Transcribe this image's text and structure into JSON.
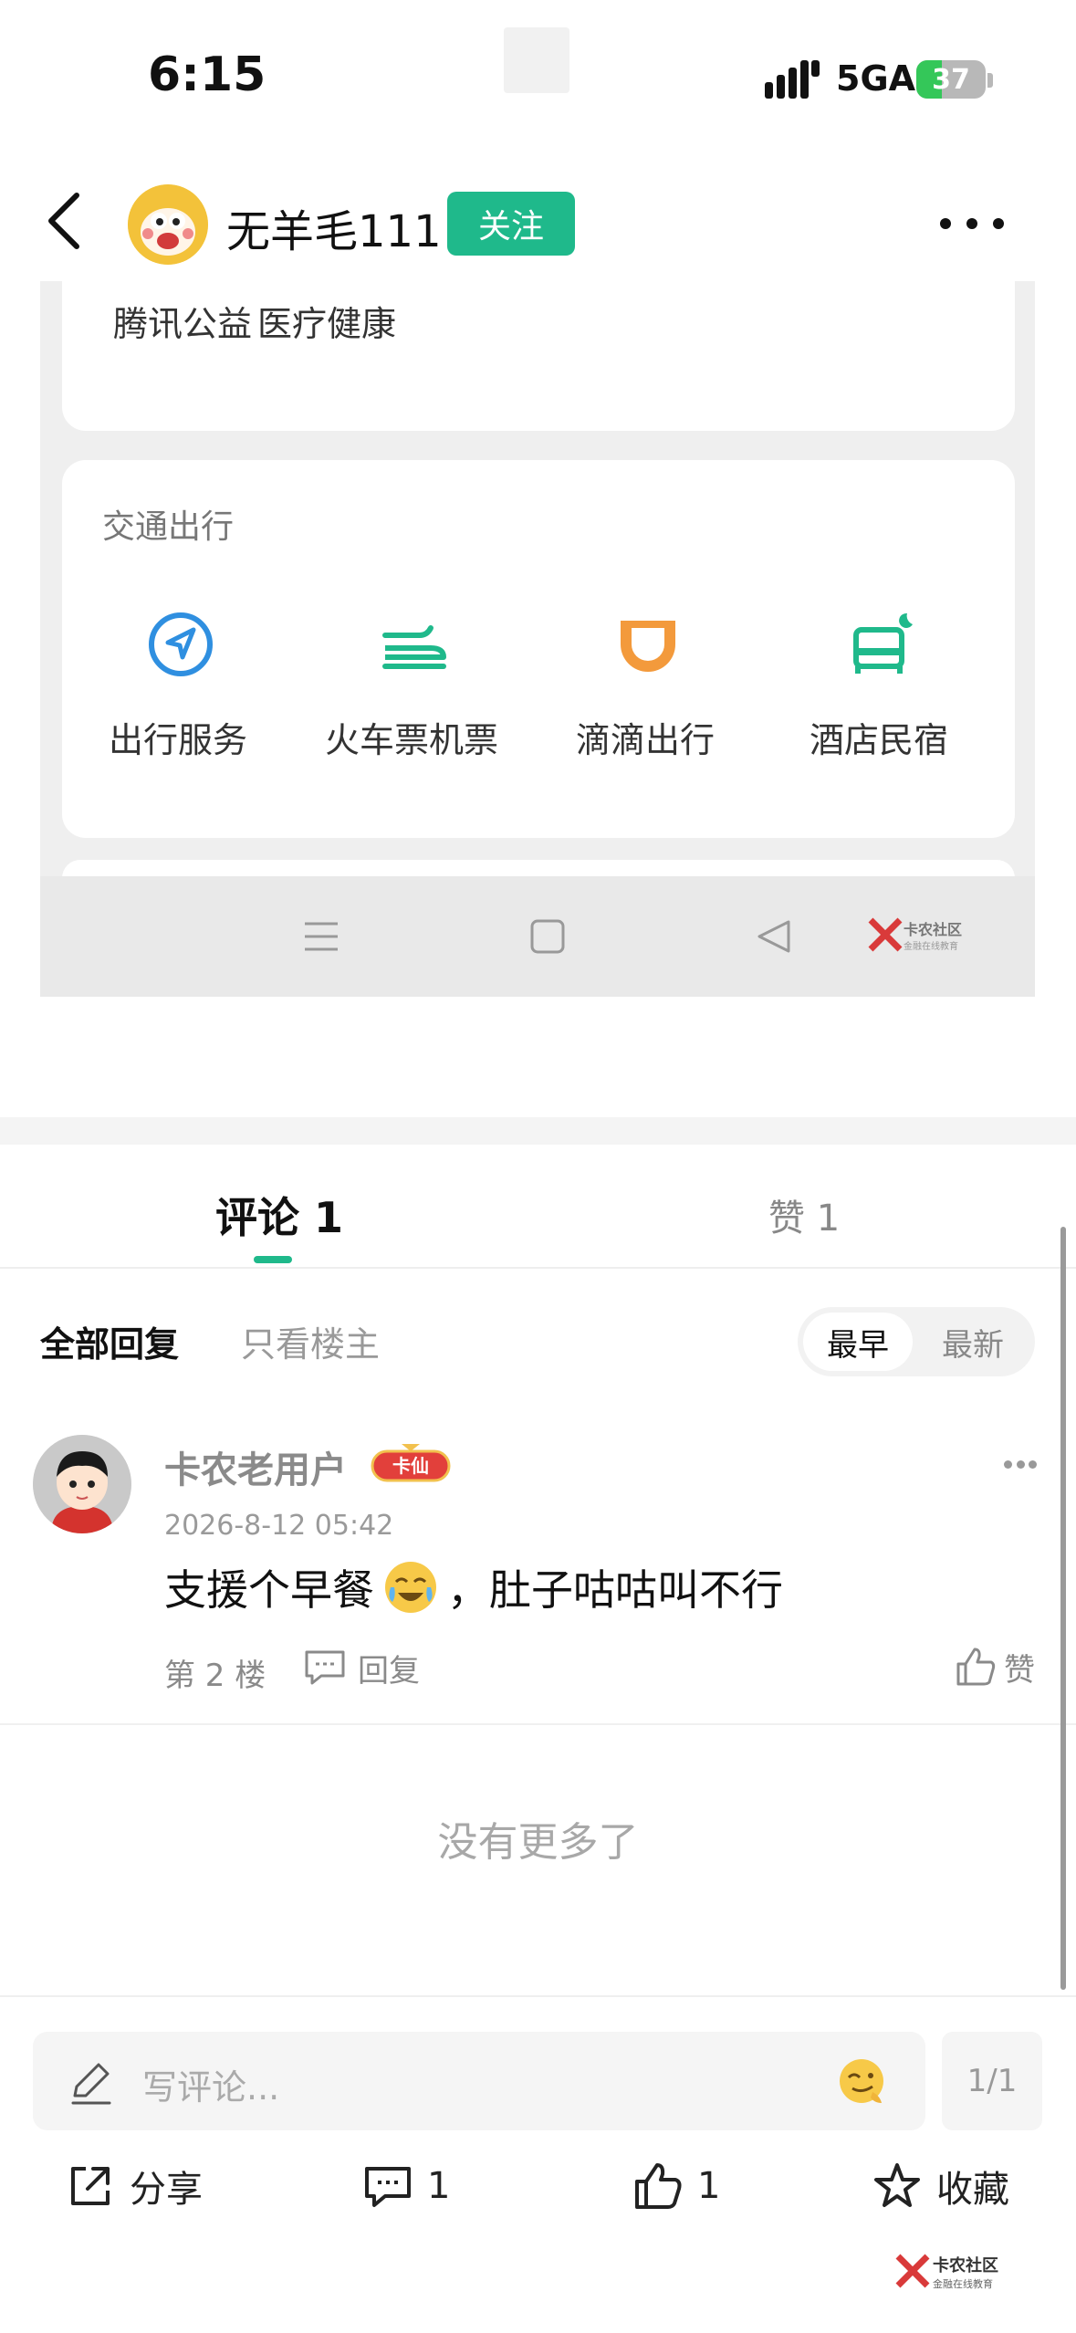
{
  "status_bar": {
    "time": "6:15",
    "network": "5GA",
    "battery": "37",
    "battery_level": 0.37
  },
  "header": {
    "author_name": "无羊毛111",
    "follow_label": "关注"
  },
  "screenshot": {
    "top_links": [
      "腾讯公益",
      "医疗健康"
    ],
    "section_title": "交通出行",
    "services": [
      {
        "label": "出行服务",
        "icon": "navigation-arrow-icon"
      },
      {
        "label": "火车票机票",
        "icon": "train-icon"
      },
      {
        "label": "滴滴出行",
        "icon": "didi-icon"
      },
      {
        "label": "酒店民宿",
        "icon": "hotel-bed-icon"
      }
    ],
    "watermark_main": "卡农社区",
    "watermark_sub": "金融在线教育"
  },
  "tabs": {
    "comments": "评论 1",
    "likes": "赞 1"
  },
  "filters": {
    "all": "全部回复",
    "op_only": "只看楼主",
    "sort_earliest": "最早",
    "sort_latest": "最新"
  },
  "comment": {
    "user": "卡农老用户",
    "badge": "卡仙",
    "time": "2026-8-12 05:42",
    "text_before": "支援个早餐",
    "text_after": "，肚子咕咕叫不行",
    "floor": "第 2 楼",
    "reply_label": "回复",
    "like_label": "赞"
  },
  "no_more": "没有更多了",
  "input": {
    "placeholder": "写评论...",
    "page": "1/1"
  },
  "actions": {
    "share": "分享",
    "comments": "1",
    "likes": "1",
    "favorite": "收藏"
  },
  "watermark": {
    "main": "卡农社区",
    "sub": "金融在线教育"
  },
  "colors": {
    "accent": "#1fb98b",
    "didi_orange": "#f39a3c",
    "nav_blue": "#2f8fe0"
  }
}
